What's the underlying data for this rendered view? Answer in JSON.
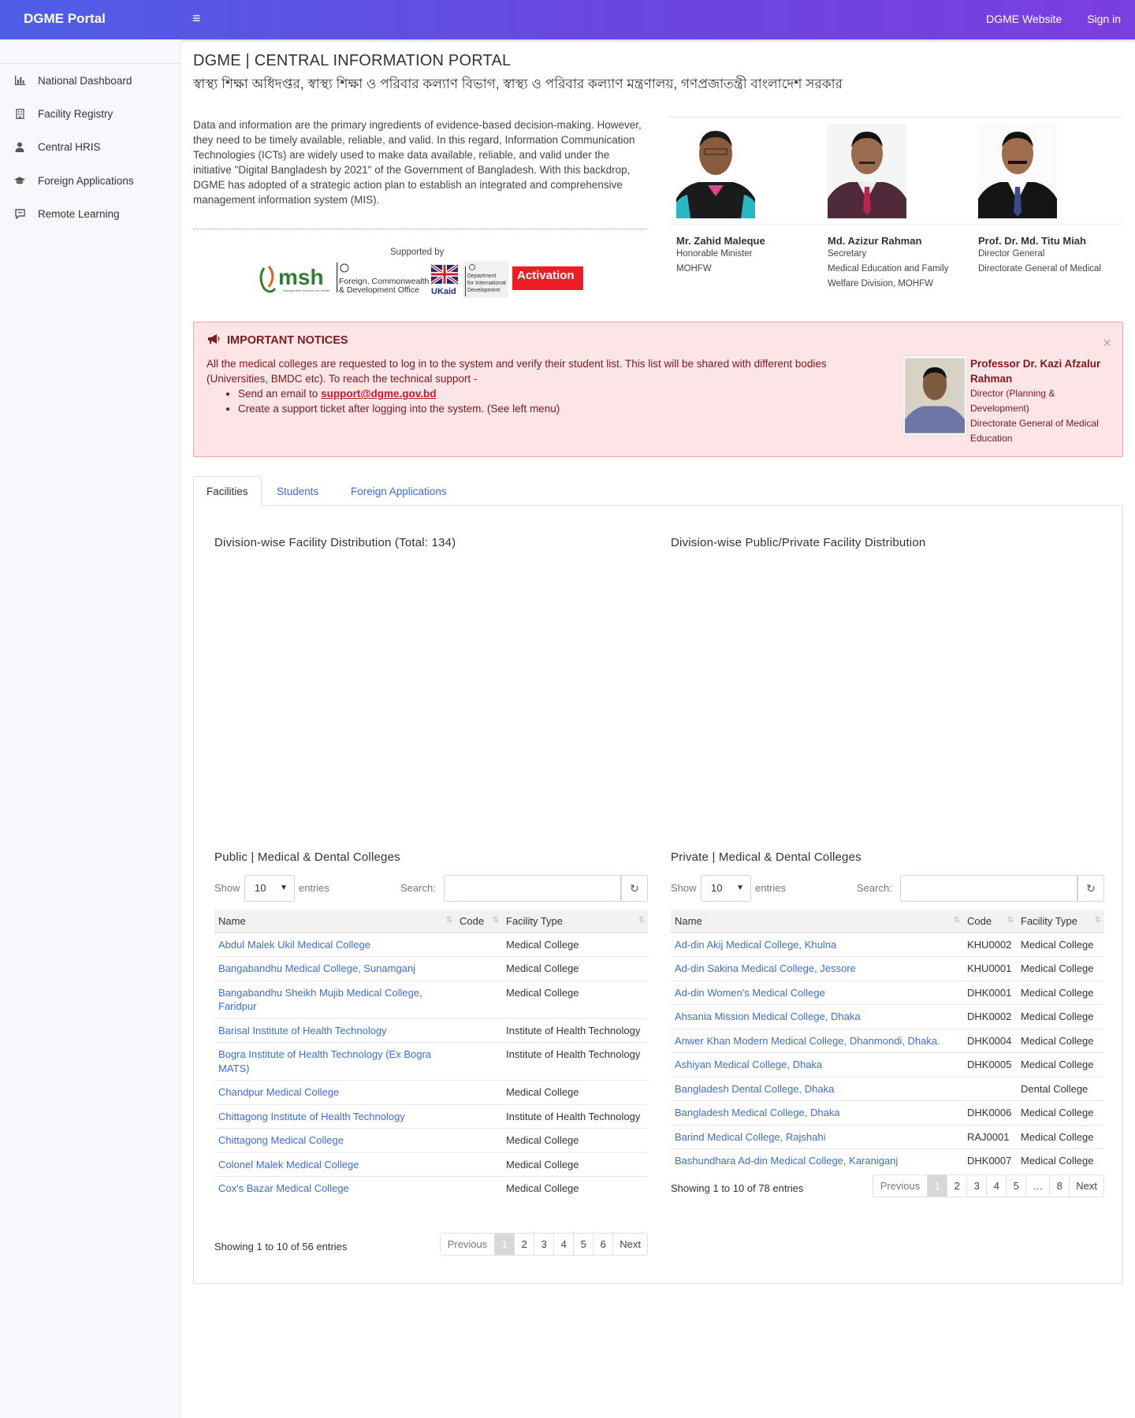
{
  "header": {
    "brand": "DGME Portal",
    "menu_icon": "≡",
    "links": [
      "DGME Website",
      "Sign in"
    ]
  },
  "sidebar": {
    "items": [
      {
        "label": "National Dashboard",
        "icon": "bar-chart-icon"
      },
      {
        "label": "Facility Registry",
        "icon": "building-icon"
      },
      {
        "label": "Central HRIS",
        "icon": "user-icon"
      },
      {
        "label": "Foreign Applications",
        "icon": "graduation-cap-icon"
      },
      {
        "label": "Remote Learning",
        "icon": "chat-icon"
      }
    ]
  },
  "page": {
    "title": "DGME | CENTRAL INFORMATION PORTAL",
    "subtitle": "স্বাস্থ্য শিক্ষা অধিদপ্তর, স্বাস্থ্য শিক্ষা ও পরিবার কল্যাণ বিভাগ, স্বাস্থ্য ও পরিবার কল্যাণ মন্ত্রণালয়, গণপ্রজাতন্ত্রী বাংলাদেশ সরকার",
    "intro": "Data and information are the primary ingredients of evidence-based decision-making. However, they need to be timely available, reliable, and valid. In this regard, Information Communication Technologies (ICTs) are widely used to make data available, reliable, and valid under the initiative \"Digital Bangladesh by 2021\" of the Government of Bangladesh. With this backdrop, DGME has adopted of a strategic action plan to establish an integrated and comprehensive management information system (MIS).",
    "supported_by": "Supported by",
    "logos": {
      "msh": "msh",
      "msh_tag": "Management Sciences for Health",
      "fcdo_line1": "Foreign, Commonwealth",
      "fcdo_line2": "& Development Office",
      "ukaid": "UKaid",
      "dfid_line1": "Department",
      "dfid_line2": "for International",
      "dfid_line3": "Development",
      "activation": "Activation"
    }
  },
  "leaders": [
    {
      "name": "Mr. Zahid Maleque",
      "lines": [
        "Honorable Minister",
        "MOHFW"
      ]
    },
    {
      "name": "Md. Azizur Rahman",
      "lines": [
        "Secretary",
        "Medical Education and Family",
        "Welfare Division, MOHFW"
      ]
    },
    {
      "name": "Prof. Dr. Md. Titu Miah",
      "lines": [
        "Director General",
        "Directorate General of Medical"
      ]
    }
  ],
  "notice": {
    "heading": "IMPORTANT NOTICES",
    "text": "All the medical colleges are requested to log in to the system and verify their student list. This list will be shared with different bodies (Universities, BMDC etc). To reach the technical support -",
    "bullet1_prefix": "Send an email to ",
    "email": "support@dgme.gov.bd",
    "bullet2": "Create a support ticket after logging into the system. (See left menu)",
    "close": "×",
    "person_name": "Professor Dr. Kazi Afzalur Rahman",
    "person_lines": [
      "Director (Planning &",
      "Development)",
      "Directorate General of Medical",
      "Education"
    ]
  },
  "tabs": [
    "Facilities",
    "Students",
    "Foreign Applications"
  ],
  "charts": {
    "left_title": "Division-wise Facility Distribution (Total: 134)",
    "right_title": "Division-wise Public/Private Facility Distribution"
  },
  "public_table": {
    "title": "Public | Medical & Dental Colleges",
    "show": "Show",
    "page_size": "10",
    "entries": "entries",
    "search_label": "Search:",
    "columns": [
      "Name",
      "Code",
      "Facility Type"
    ],
    "rows": [
      [
        "Abdul Malek Ukil Medical College",
        "",
        "Medical College"
      ],
      [
        "Bangabandhu Medical College, Sunamganj",
        "",
        "Medical College"
      ],
      [
        "Bangabandhu Sheikh Mujib Medical College, Faridpur",
        "",
        "Medical College"
      ],
      [
        "Barisal Institute of Health Technology",
        "",
        "Institute of Health Technology"
      ],
      [
        "Bogra Institute of Health Technology (Ex Bogra MATS)",
        "",
        "Institute of Health Technology"
      ],
      [
        "Chandpur Medical College",
        "",
        "Medical College"
      ],
      [
        "Chittagong Institute of Health Technology",
        "",
        "Institute of Health Technology"
      ],
      [
        "Chittagong Medical College",
        "",
        "Medical College"
      ],
      [
        "Colonel Malek Medical College",
        "",
        "Medical College"
      ],
      [
        "Cox's Bazar Medical College",
        "",
        "Medical College"
      ]
    ],
    "info": "Showing 1 to 10 of 56 entries",
    "pages": [
      "Previous",
      "1",
      "2",
      "3",
      "4",
      "5",
      "6",
      "Next"
    ]
  },
  "private_table": {
    "title": "Private | Medical & Dental Colleges",
    "show": "Show",
    "page_size": "10",
    "entries": "entries",
    "search_label": "Search:",
    "columns": [
      "Name",
      "Code",
      "Facility Type"
    ],
    "rows": [
      [
        "Ad-din Akij Medical College, Khulna",
        "KHU0002",
        "Medical College"
      ],
      [
        "Ad-din Sakina Medical College, Jessore",
        "KHU0001",
        "Medical College"
      ],
      [
        "Ad-din Women's Medical College",
        "DHK0001",
        "Medical College"
      ],
      [
        "Ahsania Mission Medical College, Dhaka",
        "DHK0002",
        "Medical College"
      ],
      [
        "Anwer Khan Modern Medical College, Dhanmondi, Dhaka.",
        "DHK0004",
        "Medical College"
      ],
      [
        "Ashiyan Medical College, Dhaka",
        "DHK0005",
        "Medical College"
      ],
      [
        "Bangladesh Dental College, Dhaka",
        "",
        "Dental College"
      ],
      [
        "Bangladesh Medical College, Dhaka",
        "DHK0006",
        "Medical College"
      ],
      [
        "Barind Medical College, Rajshahi",
        "RAJ0001",
        "Medical College"
      ],
      [
        "Bashundhara Ad-din Medical College, Karaniganj",
        "DHK0007",
        "Medical College"
      ]
    ],
    "info": "Showing 1 to 10 of 78 entries",
    "pages": [
      "Previous",
      "1",
      "2",
      "3",
      "4",
      "5",
      "…",
      "8",
      "Next"
    ]
  },
  "colors": {
    "accent": "#3b6fd1",
    "notice_bg": "#fde4e6",
    "notice_text": "#7b1a1f",
    "topbar_start": "#4f5ee6",
    "topbar_end": "#7b3ee0"
  }
}
